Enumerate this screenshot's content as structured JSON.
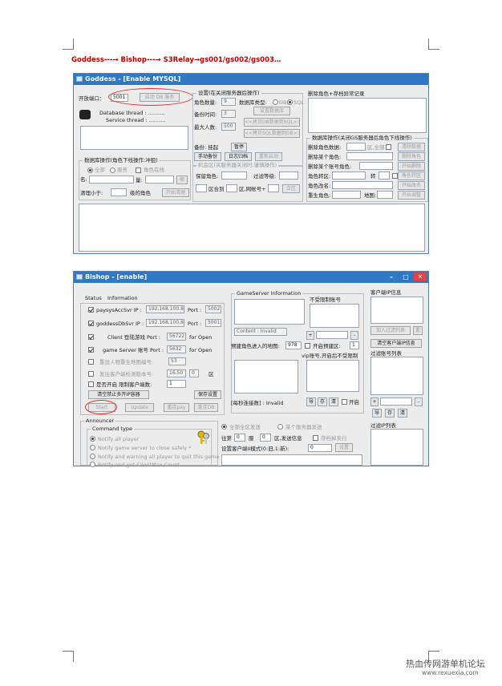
{
  "heading": "Goddess---→ Bishop---→ S3Relay→gs001/gs002/gs003…",
  "goddess": {
    "title": "Goddess - [Enable MYSQL]",
    "port_label": "开放端口：",
    "port_value": "5001",
    "start_db_btn": "启动 DB 服务",
    "db_thread": "Database thread : ..........",
    "svc_thread": "Service thread : ..........",
    "settings_title": "设置(在关闭服务器后操作)",
    "role_count_label": "角色数量:",
    "role_count": "9",
    "db_type_label": "数据库类型:",
    "db_opt": "DB",
    "sql_opt": "SQL",
    "backup_time_label": "备份时间:",
    "backup_time": "3",
    "set_db_btn": "设置数据库",
    "copy_db_sql_btn": "<<拷贝DB数据到SQL>>",
    "max_people_label": "最大人数:",
    "max_people": "500",
    "copy_sql_db_btn": "<<拷贝SQL数据到DB>>",
    "backup_label": "备份: 挂起",
    "pause_btn": "暂停",
    "manual_backup_btn": "手动备份",
    "log_archive_btn": "日志归档",
    "restart_btn": "重新启动",
    "db_role_title": "数据库操作(角色下线操作:冲狙)",
    "all_opt": "全部",
    "server_opt": "服务",
    "role_online_opt": "角色在线",
    "name_label": "名:",
    "amount_label": "量:",
    "cost_btn": "修",
    "clear_label": "清理小于:",
    "level_label": "级的角色",
    "start_clear_btn": "开始清理",
    "online_role_title": "机会区(关服务器关闭时,谨慎操作)",
    "keep_role_label": "保留角色:",
    "filter_level_label": "过滤等级:",
    "zone_to_label": "区合到",
    "zone_label": "区,网帐号+",
    "merge_btn": "合区",
    "delete_role_title": "删除角色+存档异常记录",
    "db_ops_title": "数据库操作(关闭GS服务器后角色下线操作)",
    "delete_role_data": "删除角色数据:",
    "zone_all": "区,全部",
    "clear_data_btn": "清除数据",
    "delete_one_role": "删除某个角色:",
    "delete_role_btn": "删除角色",
    "delete_acct_role": "删除某个账号角色:",
    "start_delete_btn": "开始删除",
    "role_transfer": "角色转区:",
    "transfer_label": "转",
    "role_transfer_btn": "角色转区",
    "role_rename": "角色改名:",
    "start_rename_btn": "开始改名",
    "rebirth_role": "重生角色:",
    "map_label": "地图:",
    "start_adjust_btn": "开始调整"
  },
  "bishop": {
    "title": "Bishop - [enable]",
    "status_tab": "Status",
    "info_tab": "Information",
    "paysys_label": "paysysAccSvr IP :",
    "paysys_ip": "192.168.100.8",
    "port_label": "Port :",
    "paysys_port": "5002",
    "goddess_label": "goddessDbSvr IP :",
    "goddess_ip": "192.168.100.8",
    "goddess_port": "5001",
    "client_label": "Client 登陆游戏 Port :",
    "client_port": "56722",
    "for_open": "for Open",
    "gs_label": "game Server 账号 Port :",
    "gs_port": "5632",
    "reset_map_label": "重设人物重生地图编号:",
    "reset_map_value": "53",
    "version_label": "发往客户端检测版本号:",
    "version_value": "16.50",
    "version_zero": "0",
    "zone_text": "区",
    "open_limit_label": "是否开启  限制客户端数:",
    "open_limit_value": "1",
    "clear_ban_btn": "清空禁止多开IP容器",
    "save_btn": "保存设置",
    "start_btn": "Start",
    "update_btn": "Update",
    "restart_pay_btn": "重连pay",
    "restart_db_btn": "重连DB",
    "gs_info_title": "GameServer Information",
    "content_label": "Content : Invalid",
    "no_limit_label": "不受限制账号",
    "preset_map_label": "预建角色进入的地图:",
    "preset_map_value": "978",
    "open_create_label": "开启预建区:",
    "open_create_value": "1",
    "vip_label": "vip账号,开启后不受限制",
    "conn_label": "[每秒连接数] : Invalid",
    "import_btn": "导",
    "save_small": "存",
    "clear_small": "清",
    "open_small": "开启",
    "client_ip_title": "客户端IP信息",
    "add_filter_btn": "加入过滤列表",
    "top_btn": "置",
    "clear_client_btn": "清空客户端IP信息",
    "filter_acct_title": "过滤账号列表",
    "filter_ip_title": "过滤IP列表",
    "announcer_title": "Announcer",
    "cmd_type_title": "Command type",
    "notify_all": "Notify all player",
    "notify_close": "Notify game server to close safely *",
    "notify_quit": "Notify and warning all player to quit this game *",
    "notify_count": "Notify and get ClientMax Count",
    "all_zone_send": "全部全区发送",
    "some_server_send": "某个服务器发送",
    "to_label": "往第",
    "to_value": "0",
    "server_label": "服",
    "zero2": "0",
    "send_info_label": "区,发送信息",
    "save_drop": "存档掉卖行",
    "set_client_label": "设置客户端II模式(0:旧,1:新):",
    "set_client_value": "0",
    "set_btn": "设置"
  },
  "watermark": "热血传网游单机论坛",
  "watermark_url": "www.rexuexia.com",
  "colors": {
    "titlebar": "#2f78c5",
    "highlight": "#e03030",
    "heading": "#c00000"
  }
}
